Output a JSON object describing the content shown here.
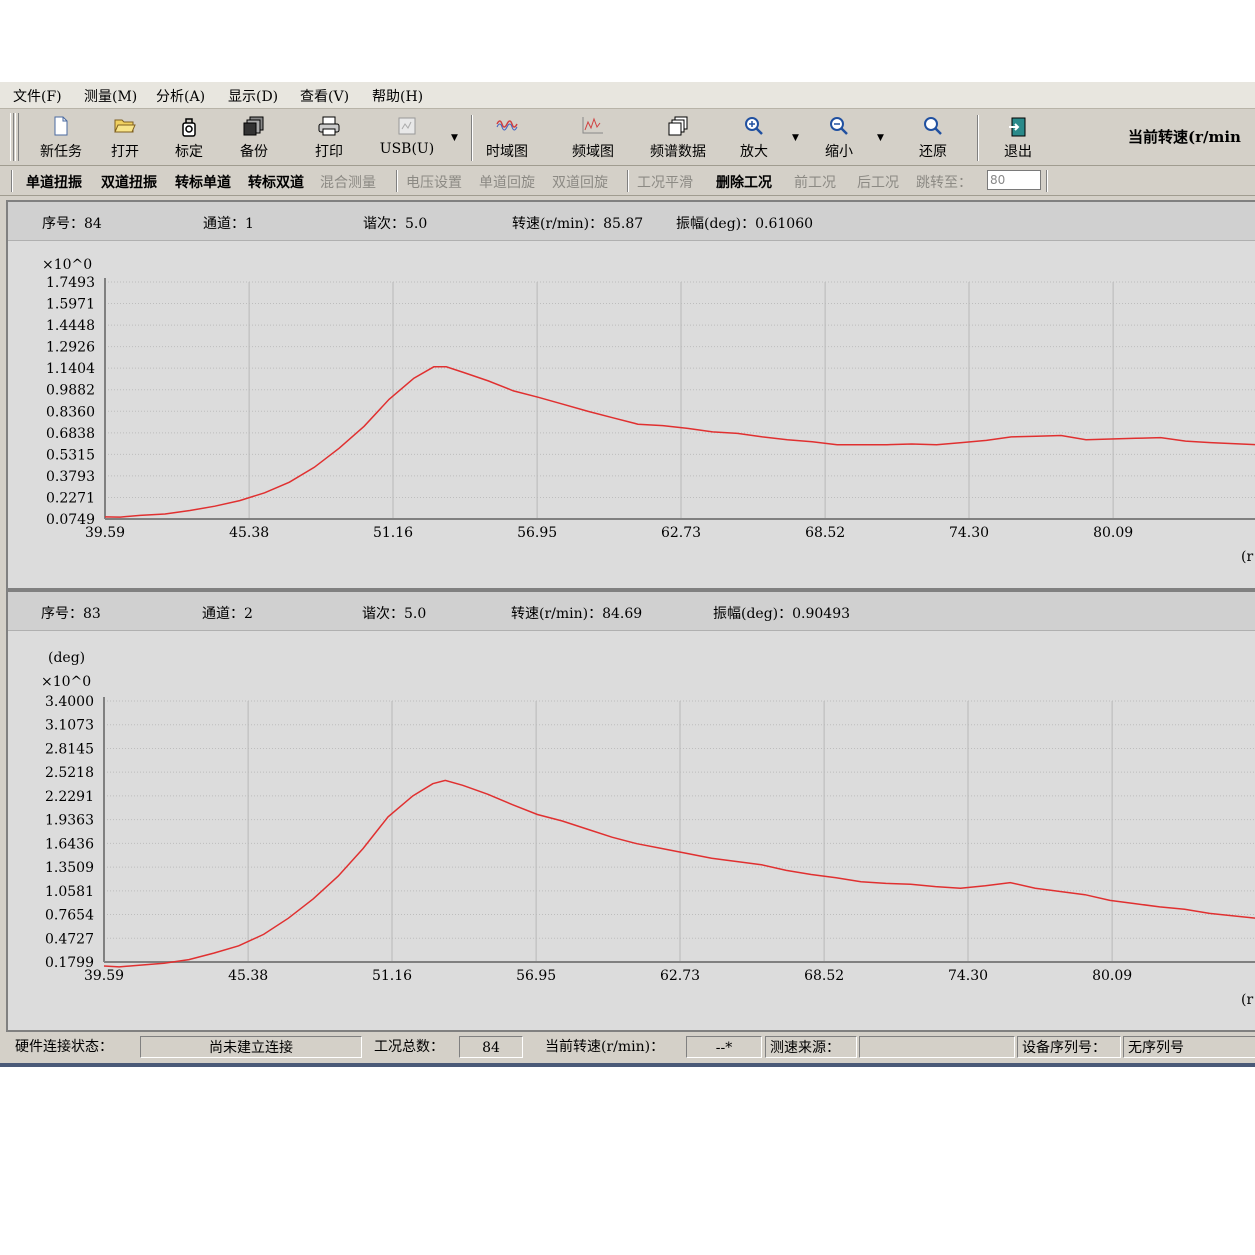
{
  "menu": [
    "文件(F)",
    "测量(M)",
    "分析(A)",
    "显示(D)",
    "查看(V)",
    "帮助(H)"
  ],
  "toolbar": {
    "new_task": "新任务",
    "open": "打开",
    "calibrate": "标定",
    "backup": "备份",
    "print": "打印",
    "usb": "USB(U)",
    "time_domain": "时域图",
    "freq_domain": "频域图",
    "spectrum_data": "频谱数据",
    "zoom_in": "放大",
    "zoom_out": "缩小",
    "restore": "还原",
    "exit": "退出",
    "current_rpm": "当前转速(r/min"
  },
  "toolbar2": {
    "single_torsion": "单道扭振",
    "dual_torsion": "双道扭振",
    "tach_single": "转标单道",
    "tach_dual": "转标双道",
    "mixed": "混合测量",
    "voltage": "电压设置",
    "single_rot": "单道回旋",
    "dual_rot": "双道回旋",
    "smooth": "工况平滑",
    "delete": "删除工况",
    "prev": "前工况",
    "next": "后工况",
    "jump_to": "跳转至：",
    "jump_value": "80"
  },
  "panel1": {
    "seq": "序号：84",
    "channel": "通道：1",
    "order": "谐次：5.0",
    "speed": "转速(r/min)：85.87",
    "amp": "振幅(deg)：0.61060"
  },
  "panel2": {
    "seq": "序号：83",
    "channel": "通道：2",
    "order": "谐次：5.0",
    "speed": "转速(r/min)：84.69",
    "amp": "振幅(deg)：0.90493"
  },
  "status": {
    "hw_label": "硬件连接状态：",
    "hw_value": "尚未建立连接",
    "total_label": "工况总数：",
    "total_value": "84",
    "rpm_label": "当前转速(r/min)：",
    "rpm_value": "--*",
    "src_label": "测速来源：",
    "src_value": "",
    "serial_label": "设备序列号：",
    "serial_value": "无序列号"
  },
  "chart_data": [
    {
      "type": "line",
      "scale_label": "×10^0",
      "ylabel": "",
      "xlabel_partial": "(r",
      "y_ticks": [
        "1.7493",
        "1.5971",
        "1.4448",
        "1.2926",
        "1.1404",
        "0.9882",
        "0.8360",
        "0.6838",
        "0.5315",
        "0.3793",
        "0.2271",
        "0.0749"
      ],
      "x_ticks": [
        "39.59",
        "45.38",
        "51.16",
        "56.95",
        "62.73",
        "68.52",
        "74.30",
        "80.09"
      ],
      "ylim": [
        0.0749,
        1.7493
      ],
      "xlim": [
        39.59,
        85.87
      ],
      "grid": true,
      "color": "#e03030",
      "x": [
        39.59,
        40.2,
        41.0,
        42.0,
        43.0,
        44.0,
        45.0,
        46.0,
        47.0,
        48.0,
        49.0,
        50.0,
        51.0,
        52.0,
        52.8,
        53.3,
        54.0,
        55.0,
        56.0,
        57.0,
        58.0,
        59.0,
        60.0,
        61.0,
        62.0,
        63.0,
        64.0,
        65.0,
        66.0,
        67.0,
        68.0,
        69.0,
        70.0,
        71.0,
        72.0,
        73.0,
        74.0,
        75.0,
        76.0,
        77.0,
        78.0,
        79.0,
        80.0,
        81.0,
        82.0,
        83.0,
        84.0,
        85.87
      ],
      "y": [
        0.09,
        0.088,
        0.1,
        0.11,
        0.135,
        0.165,
        0.205,
        0.26,
        0.335,
        0.44,
        0.575,
        0.73,
        0.92,
        1.07,
        1.15,
        1.15,
        1.11,
        1.05,
        0.98,
        0.935,
        0.885,
        0.835,
        0.79,
        0.745,
        0.735,
        0.715,
        0.69,
        0.68,
        0.655,
        0.635,
        0.62,
        0.6,
        0.6,
        0.6,
        0.605,
        0.6,
        0.615,
        0.63,
        0.655,
        0.66,
        0.665,
        0.635,
        0.64,
        0.645,
        0.65,
        0.625,
        0.615,
        0.6
      ]
    },
    {
      "type": "line",
      "scale_label": "×10^0",
      "ylabel": "(deg)",
      "xlabel_partial": "(r",
      "y_ticks": [
        "3.4000",
        "3.1073",
        "2.8145",
        "2.5218",
        "2.2291",
        "1.9363",
        "1.6436",
        "1.3509",
        "1.0581",
        "0.7654",
        "0.4727",
        "0.1799"
      ],
      "x_ticks": [
        "39.59",
        "45.38",
        "51.16",
        "56.95",
        "62.73",
        "68.52",
        "74.30",
        "80.09"
      ],
      "ylim": [
        0.1799,
        3.4
      ],
      "xlim": [
        39.59,
        85.87
      ],
      "grid": true,
      "color": "#e03030",
      "x": [
        39.59,
        40.2,
        41.0,
        42.0,
        43.0,
        44.0,
        45.0,
        46.0,
        47.0,
        48.0,
        49.0,
        50.0,
        51.0,
        52.0,
        52.8,
        53.3,
        54.0,
        55.0,
        56.0,
        57.0,
        58.0,
        59.0,
        60.0,
        61.0,
        62.0,
        63.0,
        64.0,
        65.0,
        66.0,
        67.0,
        68.0,
        69.0,
        70.0,
        71.0,
        72.0,
        73.0,
        74.0,
        75.0,
        76.0,
        77.0,
        78.0,
        79.0,
        80.0,
        81.0,
        82.0,
        83.0,
        84.0,
        85.87
      ],
      "y": [
        0.13,
        0.12,
        0.14,
        0.165,
        0.21,
        0.29,
        0.38,
        0.52,
        0.72,
        0.96,
        1.24,
        1.58,
        1.97,
        2.23,
        2.38,
        2.42,
        2.36,
        2.25,
        2.12,
        2.0,
        1.92,
        1.82,
        1.72,
        1.64,
        1.58,
        1.52,
        1.46,
        1.42,
        1.38,
        1.31,
        1.26,
        1.22,
        1.17,
        1.15,
        1.14,
        1.11,
        1.09,
        1.12,
        1.16,
        1.09,
        1.05,
        1.01,
        0.94,
        0.9,
        0.86,
        0.83,
        0.78,
        0.72
      ]
    }
  ]
}
